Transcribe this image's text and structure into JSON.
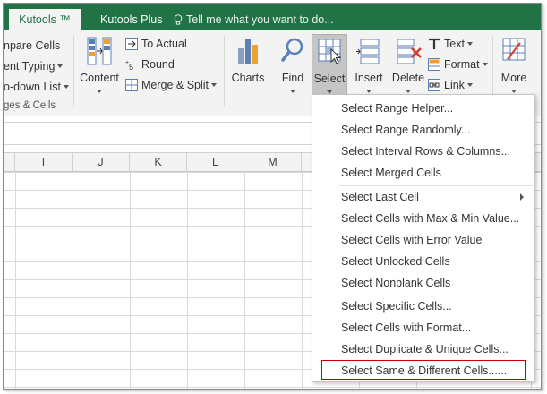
{
  "tabs": {
    "kutools": "Kutools ™",
    "kutools_plus": "Kutools Plus",
    "tell_me": "Tell me what you want to do..."
  },
  "ribbon": {
    "compare_cells": "npare Cells",
    "content_typing": "ent Typing",
    "dropdown_list": "o-down List",
    "group_label": "ges & Cells",
    "content": "Content",
    "to_actual": "To Actual",
    "round": "Round",
    "merge_split": "Merge & Split",
    "charts": "Charts",
    "find": "Find",
    "select": "Select",
    "insert": "Insert",
    "delete": "Delete",
    "text": "Text",
    "format": "Format",
    "link": "Link",
    "more": "More"
  },
  "columns": [
    "I",
    "J",
    "K",
    "L",
    "M"
  ],
  "menu": {
    "items": [
      "Select Range Helper...",
      "Select Range Randomly...",
      "Select Interval Rows & Columns...",
      "Select Merged Cells",
      "Select Last Cell",
      "Select Cells with Max & Min Value...",
      "Select Cells with Error Value",
      "Select Unlocked Cells",
      "Select Nonblank Cells",
      "Select Specific Cells...",
      "Select Cells with Format...",
      "Select Duplicate & Unique Cells...",
      "Select Same & Different Cells......"
    ]
  },
  "colors": {
    "brand": "#217346",
    "highlight_border": "#c00000"
  }
}
